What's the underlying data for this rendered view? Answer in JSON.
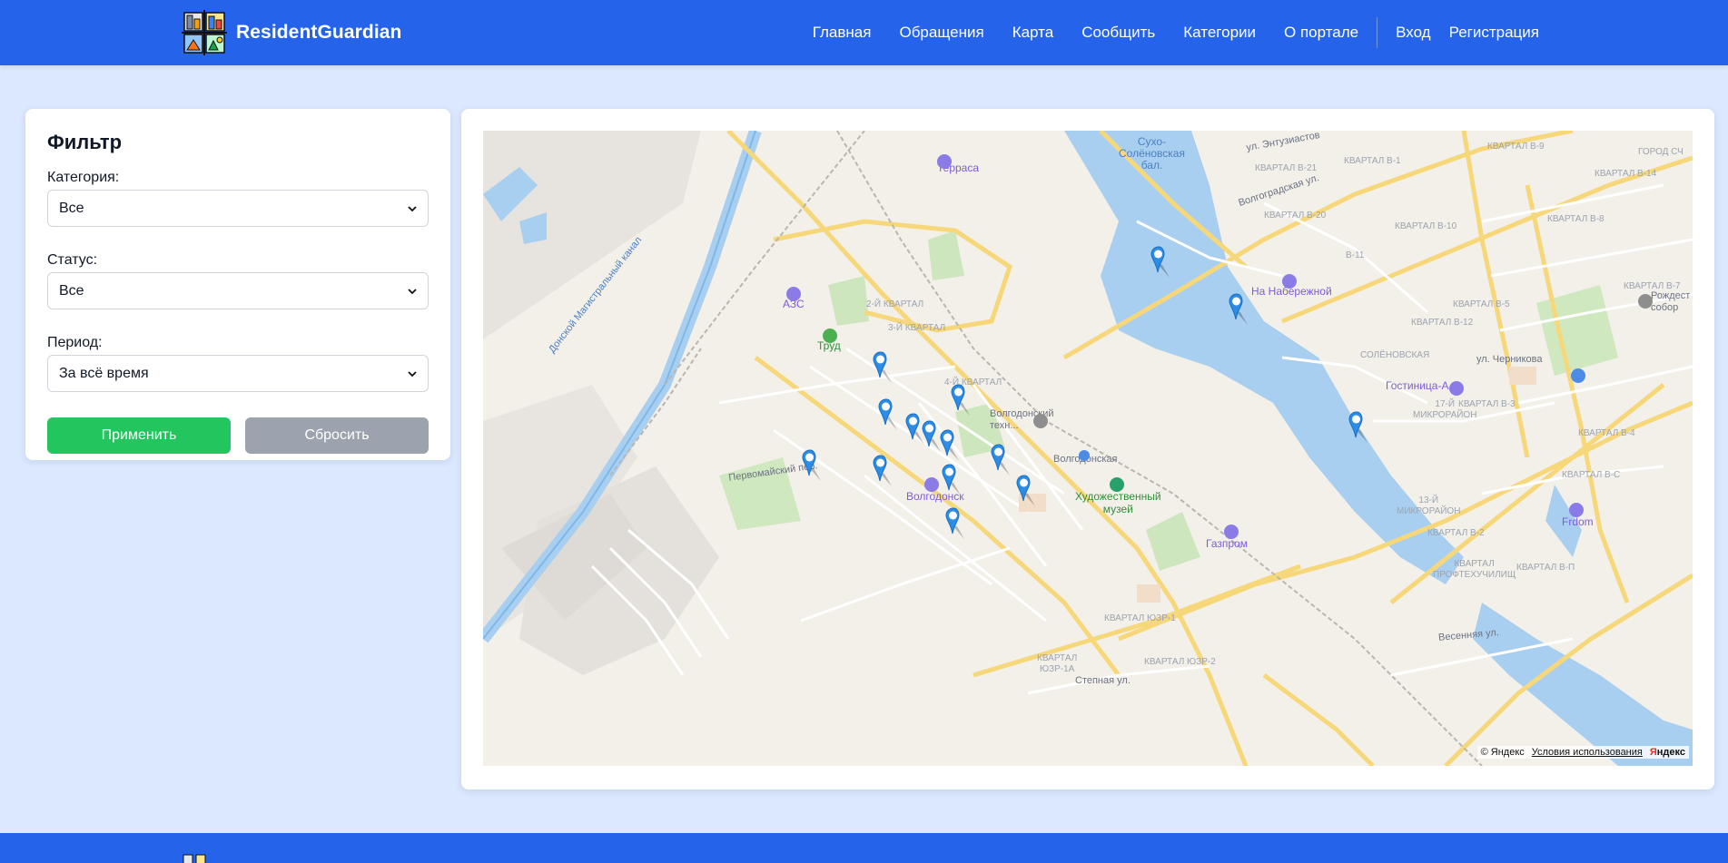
{
  "brand": {
    "name": "ResidentGuardian"
  },
  "nav": {
    "items": [
      "Главная",
      "Обращения",
      "Карта",
      "Сообщить",
      "Категории",
      "О портале"
    ],
    "login": "Вход",
    "register": "Регистрация"
  },
  "filter": {
    "title": "Фильтр",
    "category_label": "Категория:",
    "category_value": "Все",
    "status_label": "Статус:",
    "status_value": "Все",
    "period_label": "Период:",
    "period_value": "За всё время",
    "apply_label": "Применить",
    "reset_label": "Сбросить"
  },
  "map": {
    "labels": {
      "water": "Сухо-\nСолёновская\nбал.",
      "terrace": "Терраса",
      "azs": "АЗС",
      "trud": "Труд",
      "volgodonsk": "Волгодонск",
      "museum": "Художественный\nмузей",
      "gazprom": "Газпром",
      "naberezhnoy": "На Набережной",
      "gostinica": "Гостиница-А",
      "frdom": "Frdom",
      "sobor": "Рождест\nсобор",
      "tech": "Волгодонский\nтехн...",
      "station": "Волгодонская",
      "canal": "Донской Магистральный канал",
      "q2": "2-Й КВАРТАЛ",
      "q3": "3-Й КВАРТАЛ",
      "q4": "4-Й КВАРТАЛ",
      "q17": "17-Й\nМИКРОРАЙОН",
      "q13": "13-Й\nМИКРОРАЙОН",
      "solenovskaya": "СОЛЁНОВСКАЯ",
      "uzr1": "КВАРТАЛ ЮЗР-1",
      "uzr2": "КВАРТАЛ ЮЗР-2",
      "uzr1a": "КВАРТАЛ\nЮЗР-1А",
      "b9": "КВАРТАЛ В-9",
      "b14": "КВАРТАЛ В-14",
      "b8": "КВАРТАЛ В-8",
      "b7": "КВАРТАЛ В-7",
      "b5": "КВАРТАЛ В-5",
      "b3": "КВАРТАЛ В-3",
      "b4": "КВАРТАЛ В-4",
      "b2": "КВАРТАЛ В-2",
      "b10": "КВАРТАЛ В-10",
      "b11": "В-11",
      "b12": "КВАРТАЛ В-12",
      "b21": "КВАРТАЛ В-21",
      "b20": "КВАРТАЛ В-20",
      "b1": "КВАРТАЛ В-1",
      "bs": "КВАРТАЛ В-С",
      "bp": "КВАРТАЛ В-П",
      "prof": "КВАРТАЛ\nПРОФТЕХУЧИЛИЩ",
      "gorod": "ГОРОД СЧ",
      "step": "Степная ул.",
      "chernikova": "ул. Черникова",
      "pervomay": "Первомайский пер.",
      "volgogr": "Волгоградская ул.",
      "entuziastov": "ул. Энтузиастов",
      "vesennyaya": "Весенняя ул."
    },
    "markers_count": 14,
    "copyright": "© Яндекс",
    "terms": "Условия использования",
    "yandex": "Яндекс"
  }
}
